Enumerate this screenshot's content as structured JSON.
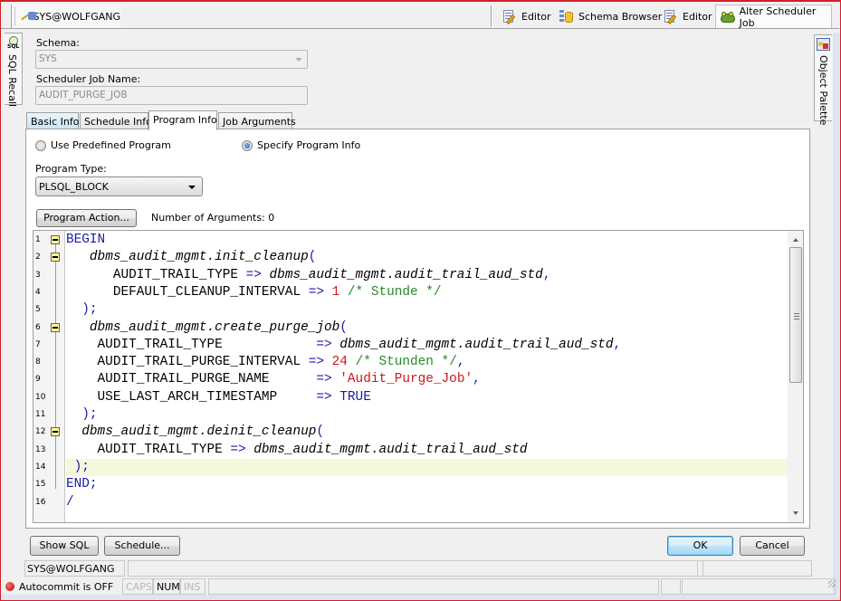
{
  "toolbar": {
    "connection_tab": "SYS@WOLFGANG",
    "window_tabs": [
      {
        "label": "Editor",
        "icon": "editor-icon",
        "active": false
      },
      {
        "label": "Schema Browser",
        "icon": "schema-browser-icon",
        "active": false
      },
      {
        "label": "Editor",
        "icon": "editor-icon",
        "active": false
      },
      {
        "label": "Alter Scheduler Job",
        "icon": "toad-icon",
        "active": true
      }
    ]
  },
  "side_panels": {
    "left": "SQL Recall",
    "right": "Object Palette"
  },
  "form": {
    "schema_label": "Schema:",
    "schema_value": "SYS",
    "job_name_label": "Scheduler Job Name:",
    "job_name_value": "AUDIT_PURGE_JOB"
  },
  "tabs": [
    {
      "label": "Basic Info",
      "active": false
    },
    {
      "label": "Schedule Info",
      "active": false
    },
    {
      "label": "Program Info",
      "active": true
    },
    {
      "label": "Job Arguments",
      "active": false
    }
  ],
  "program_info": {
    "radio_predefined": "Use Predefined Program",
    "radio_specify": "Specify Program Info",
    "selected_radio": "Specify Program Info",
    "program_type_label": "Program Type:",
    "program_type_value": "PLSQL_BLOCK",
    "program_action_button": "Program Action...",
    "num_args_text": "Number of Arguments: 0"
  },
  "code_editor": {
    "current_line": 14,
    "lines": [
      {
        "n": "1",
        "text": "BEGIN",
        "fold": true
      },
      {
        "n": "2",
        "text": "   dbms_audit_mgmt.init_cleanup(",
        "fold": true
      },
      {
        "n": "3",
        "text": "      AUDIT_TRAIL_TYPE => dbms_audit_mgmt.audit_trail_aud_std,"
      },
      {
        "n": "4",
        "text": "      DEFAULT_CLEANUP_INTERVAL => 1 /* Stunde */"
      },
      {
        "n": "5",
        "text": "  );"
      },
      {
        "n": "6",
        "text": "   dbms_audit_mgmt.create_purge_job(",
        "fold": true
      },
      {
        "n": "7",
        "text": "    AUDIT_TRAIL_TYPE            => dbms_audit_mgmt.audit_trail_aud_std,"
      },
      {
        "n": "8",
        "text": "    AUDIT_TRAIL_PURGE_INTERVAL => 24 /* Stunden */,"
      },
      {
        "n": "9",
        "text": "    AUDIT_TRAIL_PURGE_NAME      => 'Audit_Purge_Job',"
      },
      {
        "n": "10",
        "text": "    USE_LAST_ARCH_TIMESTAMP     => TRUE"
      },
      {
        "n": "11",
        "text": "  );"
      },
      {
        "n": "12",
        "text": "  dbms_audit_mgmt.deinit_cleanup(",
        "fold": true
      },
      {
        "n": "13",
        "text": "    AUDIT_TRAIL_TYPE => dbms_audit_mgmt.audit_trail_aud_std"
      },
      {
        "n": "14",
        "text": " );"
      },
      {
        "n": "15",
        "text": "END;"
      },
      {
        "n": "16",
        "text": "/"
      }
    ]
  },
  "buttons": {
    "show_sql": "Show SQL",
    "schedule": "Schedule...",
    "ok": "OK",
    "cancel": "Cancel"
  },
  "status": {
    "connection": "SYS@WOLFGANG",
    "autocommit": "Autocommit is OFF",
    "caps": "CAPS",
    "num": "NUM",
    "ins": "INS"
  }
}
